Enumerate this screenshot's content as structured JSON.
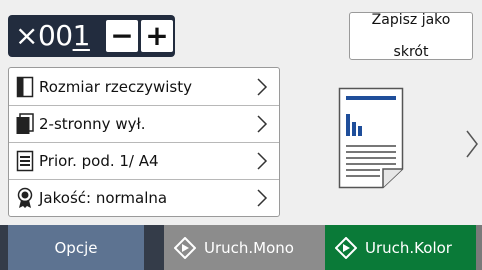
{
  "copies": {
    "prefix": "×00",
    "last_digit": "1",
    "minus_label": "−",
    "plus_label": "+"
  },
  "shortcut_button": {
    "line1": "Zapisz jako",
    "line2": "skrót"
  },
  "menu": {
    "items": [
      {
        "label": "Rozmiar rzeczywisty",
        "icon": "page-size-icon"
      },
      {
        "label": "2-stronny wył.",
        "icon": "duplex-icon"
      },
      {
        "label": "Prior. pod. 1/ A4",
        "icon": "tray-icon"
      },
      {
        "label": "Jakość: normalna",
        "icon": "quality-icon"
      }
    ]
  },
  "bottom": {
    "options_label": "Opcje",
    "mono_label": "Uruch.Mono",
    "color_label": "Uruch.Kolor"
  },
  "colors": {
    "copies_bg": "#222c3e",
    "options_bg": "#5d7391",
    "mono_bg": "#8c8c8c",
    "color_bg": "#0a7a38",
    "chart_blue": "#1f4e9a"
  }
}
